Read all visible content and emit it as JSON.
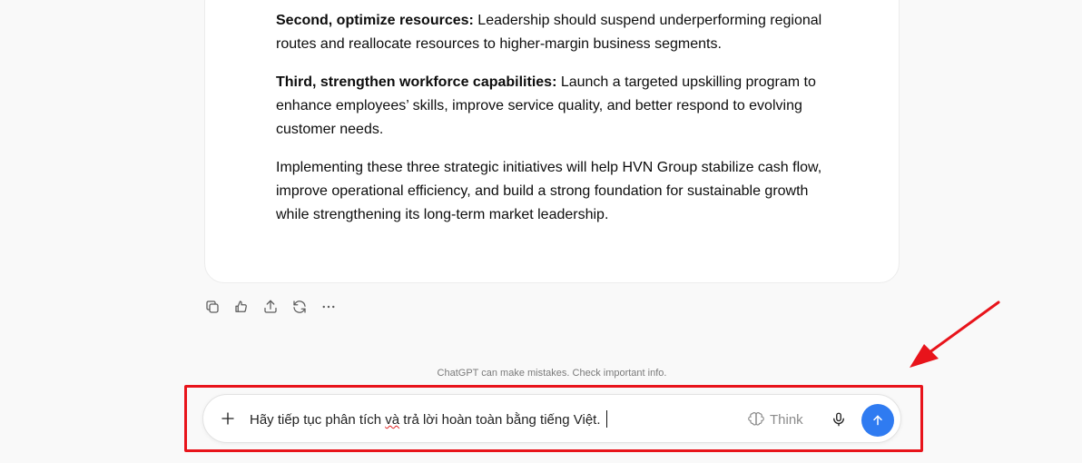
{
  "message": {
    "paragraphs": [
      {
        "lead": "Second, optimize resources:",
        "text": " Leadership should suspend underperforming regional routes and reallocate resources to higher-margin business segments."
      },
      {
        "lead": "Third, strengthen workforce capabilities:",
        "text": " Launch a targeted upskilling program to enhance employees’ skills, improve service quality, and better respond to evolving customer needs."
      },
      {
        "lead": "",
        "text": "Implementing these three strategic initiatives will help HVN Group stabilize cash flow, improve operational efficiency, and build a strong foundation for sustainable growth while strengthening its long-term market leadership."
      }
    ]
  },
  "actions": {
    "icons": [
      "copy-icon",
      "feedback-icon",
      "share-icon",
      "regenerate-icon",
      "more-icon"
    ]
  },
  "disclaimer": "ChatGPT can make mistakes. Check important info.",
  "composer": {
    "input_before": "Hãy tiếp tục phân tích ",
    "input_flagged": "và",
    "input_after": " trả lời hoàn toàn bằng tiếng Việt.",
    "think_label": "Think"
  },
  "colors": {
    "accent": "#2f7bf1",
    "annotation": "#e8141b"
  }
}
